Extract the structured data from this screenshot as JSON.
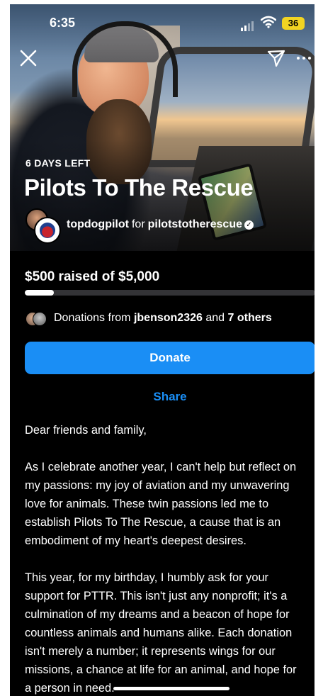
{
  "status_bar": {
    "time": "6:35",
    "battery": "36"
  },
  "campaign": {
    "days_left": "6 DAYS LEFT",
    "title": "Pilots To The Rescue",
    "organizer": "topdogpilot",
    "for_text": "for",
    "beneficiary": "pilotstotherescue"
  },
  "fundraiser": {
    "raised_text": "$500 raised of $5,000",
    "progress_fraction": 0.1,
    "donations_prefix": "Donations from",
    "top_donor": "jbenson2326",
    "and_text": "and",
    "others_text": "7 others",
    "donate_label": "Donate",
    "share_label": "Share"
  },
  "description": {
    "greeting": "Dear friends and family,",
    "paragraph1": [
      "As I celebrate another year, I can't help but reflect on",
      "my passions: my joy of aviation and my unwavering",
      "love for animals. These twin passions led me to",
      "establish Pilots To The Rescue, a cause that is an",
      "embodiment of my heart's deepest desires."
    ],
    "paragraph2": [
      "This year, for my birthday, I humbly ask for your",
      "support for PTTR. This isn't just any nonprofit; it's a",
      "culmination of my dreams and a beacon of hope for",
      "countless animals and humans alike. Each donation",
      "isn't merely a number; it represents wings for our",
      "missions, a chance at life for an animal, and hope for",
      "a person in need."
    ]
  },
  "colors": {
    "accent": "#1a8ef5",
    "background": "#000000",
    "battery": "#f2d422"
  },
  "icons": {
    "close": "close-icon",
    "send": "send-icon",
    "more": "more-icon",
    "verified": "verified-badge-icon"
  }
}
